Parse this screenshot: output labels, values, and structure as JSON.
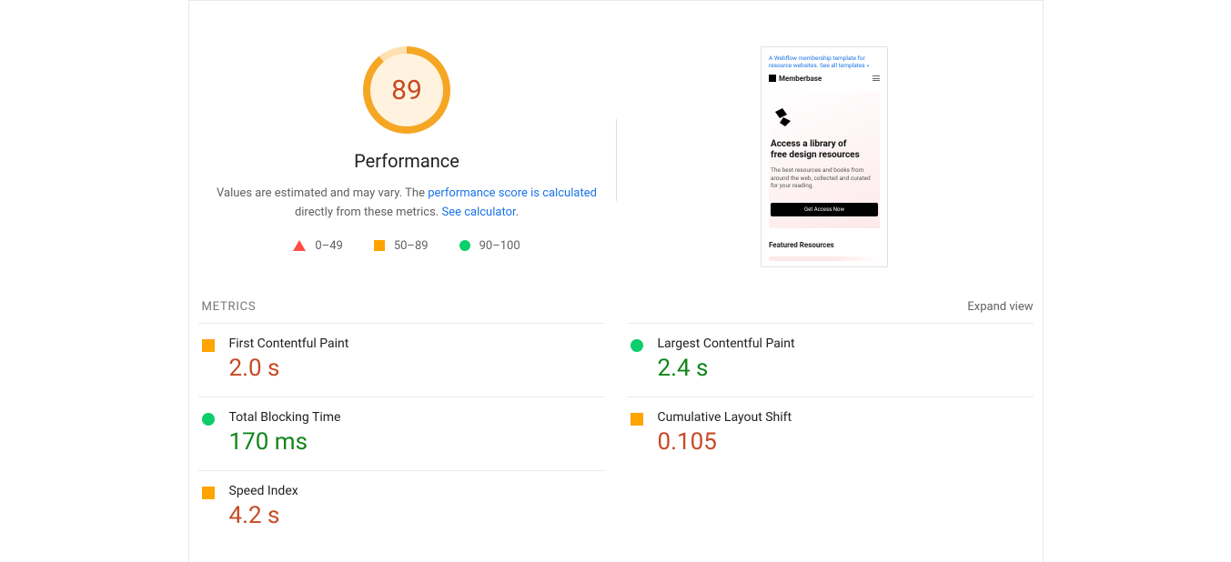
{
  "gauge": {
    "score": "89",
    "label": "Performance",
    "desc_prefix": "Values are estimated and may vary. The ",
    "calc_link": "performance score is calculated",
    "desc_mid": " directly from these metrics. ",
    "see_link": "See calculator",
    "desc_suffix": "."
  },
  "legend": {
    "poor": "0–49",
    "avg": "50–89",
    "good": "90–100"
  },
  "preview": {
    "tagline_a": "A Webflow membership template for resource websites. ",
    "tagline_b": "See all templates »",
    "brand": "Memberbase",
    "hero_title_1": "Access a library of",
    "hero_title_2": "free design resources",
    "hero_sub": "The best resources and books from around the web, collected and curated for your reading.",
    "cta": "Get Access Now",
    "featured": "Featured Resources"
  },
  "metrics_header": {
    "label": "METRICS",
    "expand": "Expand view"
  },
  "metrics": {
    "fcp_name": "First Contentful Paint",
    "fcp_val": "2.0 s",
    "lcp_name": "Largest Contentful Paint",
    "lcp_val": "2.4 s",
    "tbt_name": "Total Blocking Time",
    "tbt_val": "170 ms",
    "cls_name": "Cumulative Layout Shift",
    "cls_val": "0.105",
    "si_name": "Speed Index",
    "si_val": "4.2 s"
  }
}
